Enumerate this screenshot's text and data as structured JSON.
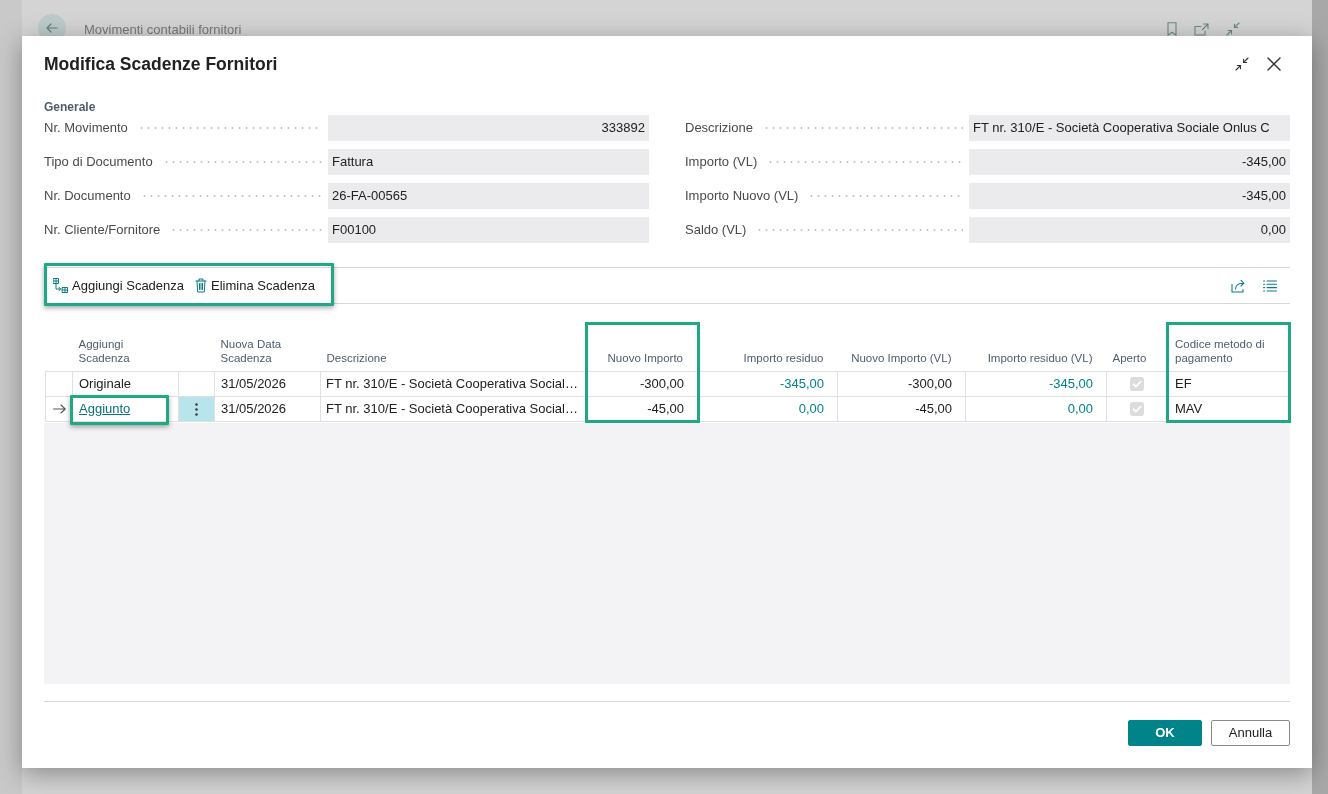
{
  "background_page": {
    "title": "Movimenti contabili fornitori"
  },
  "dialog": {
    "title": "Modifica Scadenze Fornitori"
  },
  "general": {
    "heading": "Generale",
    "fields_left": [
      {
        "label": "Nr. Movimento",
        "value": "333892",
        "kind": "number"
      },
      {
        "label": "Tipo di Documento",
        "value": "Fattura",
        "kind": "text"
      },
      {
        "label": "Nr. Documento",
        "value": "26-FA-00565",
        "kind": "text"
      },
      {
        "label": "Nr. Cliente/Fornitore",
        "value": "F00100",
        "kind": "text"
      }
    ],
    "fields_right": [
      {
        "label": "Descrizione",
        "value": "FT nr. 310/E - Società Cooperativa Sociale Onlus C",
        "kind": "text"
      },
      {
        "label": "Importo (VL)",
        "value": "-345,00",
        "kind": "number"
      },
      {
        "label": "Importo Nuovo (VL)",
        "value": "-345,00",
        "kind": "number"
      },
      {
        "label": "Saldo (VL)",
        "value": "0,00",
        "kind": "number"
      }
    ]
  },
  "toolbar": {
    "highlighted": true,
    "actions": [
      {
        "label": "Aggiungi Scadenza"
      },
      {
        "label": "Elimina Scadenza"
      }
    ]
  },
  "grid": {
    "columns": [
      {
        "kind": "marker"
      },
      {
        "label": "Aggiungi Scadenza",
        "kind": "caption",
        "highlighted": false
      },
      {
        "kind": "menu"
      },
      {
        "label": "Nuova Data Scadenza",
        "kind": "text",
        "highlighted": false
      },
      {
        "label": "Descrizione",
        "kind": "text",
        "highlighted": false
      },
      {
        "label": "Nuovo Importo",
        "kind": "number",
        "highlighted": true
      },
      {
        "label": "Importo residuo",
        "kind": "drilldown",
        "highlighted": false
      },
      {
        "label": "Nuovo Importo (VL)",
        "kind": "number",
        "highlighted": false
      },
      {
        "label": "Importo residuo (VL)",
        "kind": "drilldown",
        "highlighted": false
      },
      {
        "label": "Aperto",
        "kind": "checkbox",
        "disabled": true,
        "highlighted": false
      },
      {
        "label": "Codice metodo di pagamento",
        "kind": "text",
        "highlighted": true
      }
    ],
    "rows": [
      {
        "current": false,
        "first_cell_highlighted": false,
        "cells": [
          "",
          "Originale",
          "",
          "31/05/2026",
          "FT nr. 310/E - Società Cooperativa Social…",
          "-300,00",
          "-345,00",
          "-300,00",
          "-345,00",
          true,
          "EF"
        ]
      },
      {
        "current": true,
        "first_cell_highlighted": true,
        "cells": [
          "",
          "Aggiunto",
          "",
          "31/05/2026",
          "FT nr. 310/E - Società Cooperativa Social…",
          "-45,00",
          "0,00",
          "-45,00",
          "0,00",
          true,
          "MAV"
        ]
      }
    ]
  },
  "buttons": [
    {
      "label": "OK",
      "primary": true
    },
    {
      "label": "Annulla",
      "primary": false
    }
  ]
}
